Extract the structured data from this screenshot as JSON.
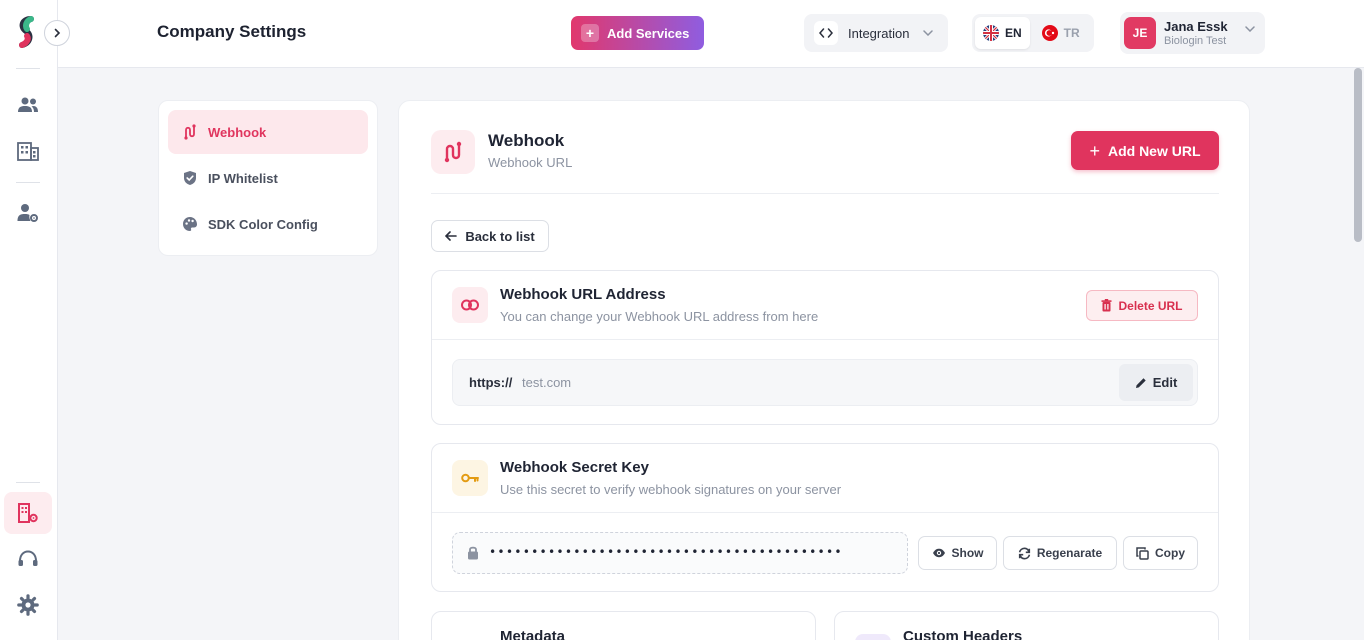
{
  "header": {
    "page_title": "Company Settings",
    "add_services_label": "Add Services",
    "integration_label": "Integration",
    "languages": [
      {
        "code": "EN",
        "selected": true
      },
      {
        "code": "TR",
        "selected": false
      }
    ],
    "user": {
      "initials": "JE",
      "name": "Jana Essk",
      "org": "Biologin Test"
    }
  },
  "settings_nav": {
    "items": [
      {
        "label": "Webhook",
        "icon": "webhook-icon",
        "active": true
      },
      {
        "label": "IP Whitelist",
        "icon": "shield-check-icon",
        "active": false
      },
      {
        "label": "SDK Color Config",
        "icon": "palette-icon",
        "active": false
      }
    ]
  },
  "main": {
    "title": "Webhook",
    "subtitle": "Webhook URL",
    "add_url_label": "Add New URL",
    "back_label": "Back to list",
    "url_section": {
      "title": "Webhook URL Address",
      "subtitle": "You can change your Webhook URL address from here",
      "delete_label": "Delete URL",
      "protocol": "https://",
      "host": "test.com",
      "edit_label": "Edit"
    },
    "secret_section": {
      "title": "Webhook Secret Key",
      "subtitle": "Use this secret to verify webhook signatures on your server",
      "masked_value": "••••••••••••••••••••••••••••••••••••••••••",
      "show_label": "Show",
      "regenerate_label": "Regenarate",
      "copy_label": "Copy"
    },
    "metadata_title": "Metadata",
    "custom_headers_title": "Custom Headers"
  },
  "colors": {
    "accent": "#e0345e",
    "accent_soft": "#fdecef",
    "gradient_start": "#e1386d",
    "gradient_end": "#8f5de0",
    "key_icon": "#e39b12"
  }
}
